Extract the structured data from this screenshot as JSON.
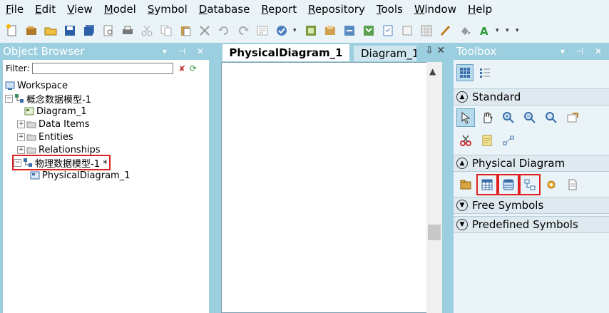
{
  "menu": [
    "File",
    "Edit",
    "View",
    "Model",
    "Symbol",
    "Database",
    "Report",
    "Repository",
    "Tools",
    "Window",
    "Help"
  ],
  "menu_mnemonic": [
    "F",
    "E",
    "V",
    "M",
    "S",
    "D",
    "R",
    "R",
    "T",
    "W",
    "H"
  ],
  "object_browser": {
    "title": "Object Browser",
    "filter_label": "Filter:",
    "filter_value": "",
    "tree": [
      {
        "label": "Workspace",
        "icon": "workspace-icon"
      },
      {
        "label": "概念数据模型-1",
        "icon": "cdm-model-icon"
      },
      {
        "label": "Diagram_1",
        "icon": "diagram-icon"
      },
      {
        "label": "Data Items",
        "icon": "folder-icon"
      },
      {
        "label": "Entities",
        "icon": "folder-icon"
      },
      {
        "label": "Relationships",
        "icon": "folder-icon"
      },
      {
        "label": "物理数据模型-1 *",
        "icon": "pdm-model-icon"
      },
      {
        "label": "PhysicalDiagram_1",
        "icon": "physical-diagram-icon"
      }
    ]
  },
  "editor": {
    "tabs": [
      "PhysicalDiagram_1",
      "Diagram_1"
    ]
  },
  "toolbox": {
    "title": "Toolbox",
    "sections": {
      "standard": "Standard",
      "physical": "Physical Diagram",
      "free": "Free Symbols",
      "predefined": "Predefined Symbols"
    }
  },
  "colors": {
    "frame": "#9bcfe0",
    "menubar": "#e9f3f8",
    "highlight": "#e02020"
  }
}
